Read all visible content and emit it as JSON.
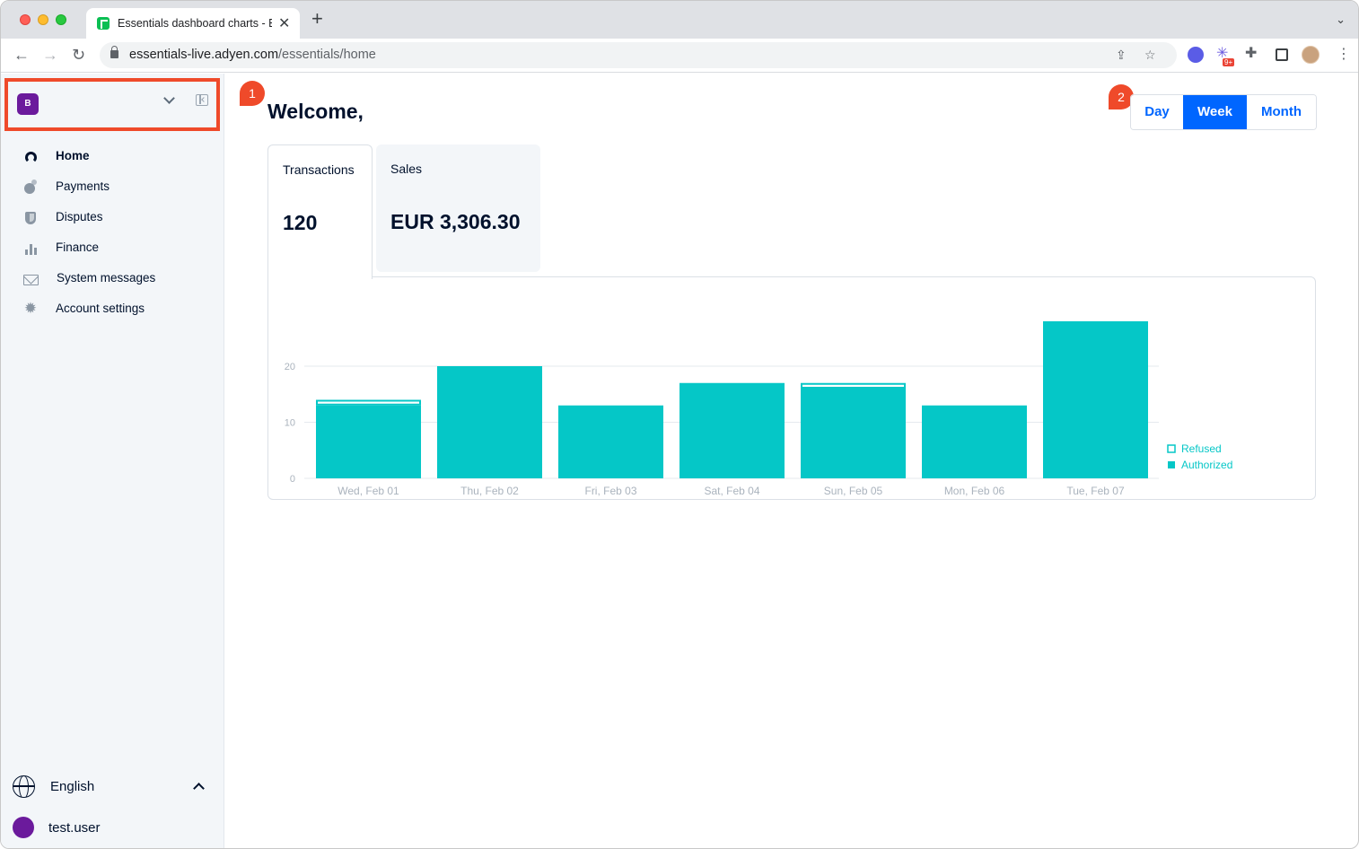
{
  "browser": {
    "tab_title": "Essentials dashboard charts - Essentials",
    "tab_close": "✕",
    "new_tab": "+",
    "tab_menu": "⌄",
    "url_host": "essentials-live.adyen.com",
    "url_path": "/essentials/home",
    "extension_badge": "9+"
  },
  "sidebar": {
    "account_initial": "B",
    "items": [
      {
        "label": "Home",
        "icon": "dashboard-icon",
        "active": true
      },
      {
        "label": "Payments",
        "icon": "payments-icon",
        "active": false
      },
      {
        "label": "Disputes",
        "icon": "shield-icon",
        "active": false
      },
      {
        "label": "Finance",
        "icon": "bar-chart-icon",
        "active": false
      },
      {
        "label": "System messages",
        "icon": "mail-icon",
        "active": false
      },
      {
        "label": "Account settings",
        "icon": "gear-icon",
        "active": false
      }
    ],
    "language": "English",
    "user": "test.user"
  },
  "annotations": [
    "1",
    "2"
  ],
  "main": {
    "welcome": "Welcome,",
    "period": {
      "options": [
        "Day",
        "Week",
        "Month"
      ],
      "selected": "Week"
    },
    "kpis": {
      "transactions_label": "Transactions",
      "transactions_value": "120",
      "sales_label": "Sales",
      "sales_value": "EUR 3,306.30"
    }
  },
  "colors": {
    "accent": "#0066ff",
    "bar": "#05c7c7",
    "annotation": "#ef4a2a",
    "account_purple": "#6b1a9c"
  },
  "chart_data": {
    "type": "bar",
    "stacked": true,
    "categories": [
      "Wed, Feb 01",
      "Thu, Feb 02",
      "Fri, Feb 03",
      "Sat, Feb 04",
      "Sun, Feb 05",
      "Mon, Feb 06",
      "Tue, Feb 07"
    ],
    "series": [
      {
        "name": "Authorized",
        "values": [
          13,
          20,
          13,
          17,
          16,
          13,
          28
        ],
        "style": "filled"
      },
      {
        "name": "Refused",
        "values": [
          1,
          0,
          0,
          0,
          1,
          0,
          0
        ],
        "style": "outline"
      }
    ],
    "yticks": [
      0,
      10,
      20
    ],
    "ylim": [
      0,
      30
    ],
    "legend_order": [
      "Refused",
      "Authorized"
    ],
    "legend_position": "right",
    "grid": true
  }
}
